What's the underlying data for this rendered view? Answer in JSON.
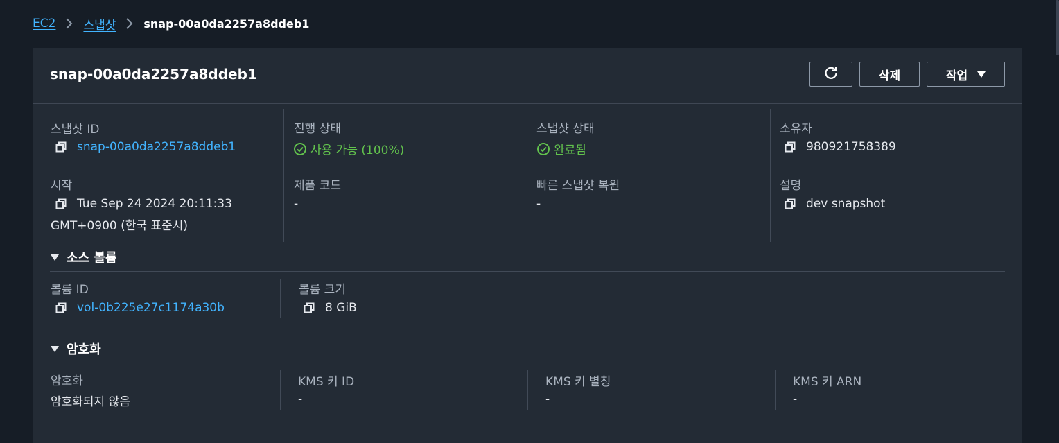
{
  "breadcrumb": {
    "root": "EC2",
    "parent": "스냅샷",
    "current": "snap-00a0da2257a8ddeb1"
  },
  "header": {
    "title": "snap-00a0da2257a8ddeb1",
    "refresh_icon": "refresh-icon",
    "delete_label": "삭제",
    "actions_label": "작업"
  },
  "details": {
    "snapshot_id_label": "스냅샷 ID",
    "snapshot_id": "snap-00a0da2257a8ddeb1",
    "progress_label": "진행 상태",
    "progress_value": "사용 가능 (100%)",
    "snapshot_state_label": "스냅샷 상태",
    "snapshot_state": "완료됨",
    "owner_label": "소유자",
    "owner": "980921758389",
    "started_label": "시작",
    "started_line1": "Tue Sep 24 2024 20:11:33",
    "started_line2": "GMT+0900 (한국 표준시)",
    "product_codes_label": "제품 코드",
    "product_codes": "-",
    "fast_restore_label": "빠른 스냅샷 복원",
    "fast_restore": "-",
    "description_label": "설명",
    "description": "dev snapshot"
  },
  "source_volume": {
    "title": "소스 볼륨",
    "volume_id_label": "볼륨 ID",
    "volume_id": "vol-0b225e27c1174a30b",
    "volume_size_label": "볼륨 크기",
    "volume_size": "8 GiB"
  },
  "encryption": {
    "title": "암호화",
    "encryption_label": "암호화",
    "encryption_value": "암호화되지 않음",
    "kms_key_id_label": "KMS 키 ID",
    "kms_key_id": "-",
    "kms_key_alias_label": "KMS 키 별칭",
    "kms_key_alias": "-",
    "kms_key_arn_label": "KMS 키 ARN",
    "kms_key_arn": "-"
  },
  "colors": {
    "background": "#161d26",
    "panel": "#232b35",
    "link": "#42b4ff",
    "success": "#62c24d"
  }
}
